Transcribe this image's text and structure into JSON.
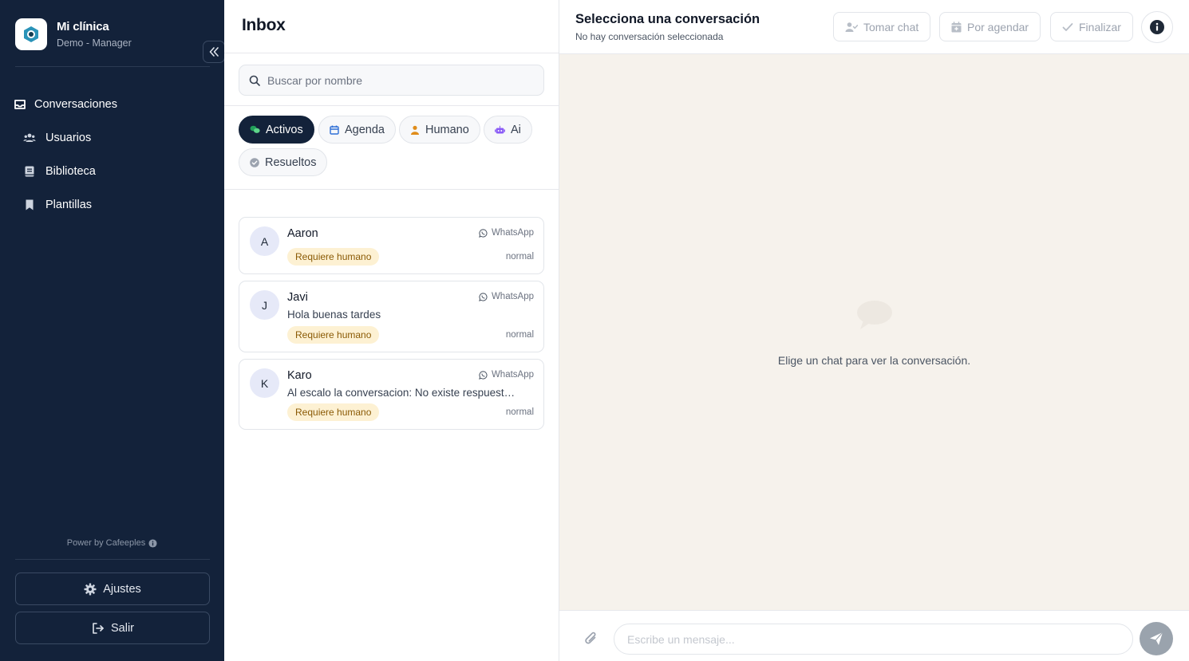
{
  "sidebar": {
    "brand_name": "Mi clínica",
    "brand_role": "Demo - Manager",
    "nav": [
      {
        "label": "Conversaciones",
        "icon": "inbox-icon"
      },
      {
        "label": "Usuarios",
        "icon": "users-icon"
      },
      {
        "label": "Biblioteca",
        "icon": "book-icon"
      },
      {
        "label": "Plantillas",
        "icon": "bookmark-icon"
      }
    ],
    "powered_by": "Power by Cafeeples",
    "settings_label": "Ajustes",
    "logout_label": "Salir"
  },
  "inbox": {
    "title": "Inbox",
    "search_placeholder": "Buscar por nombre",
    "filters": [
      {
        "label": "Activos",
        "active": true,
        "icon": "chat-bubbles-icon"
      },
      {
        "label": "Agenda",
        "active": false,
        "icon": "calendar-icon"
      },
      {
        "label": "Humano",
        "active": false,
        "icon": "person-icon"
      },
      {
        "label": "Ai",
        "active": false,
        "icon": "robot-icon"
      },
      {
        "label": "Resueltos",
        "active": false,
        "icon": "check-circle-icon"
      }
    ],
    "conversations": [
      {
        "initial": "A",
        "name": "Aaron",
        "channel": "WhatsApp",
        "message": "",
        "badge": "Requiere humano",
        "priority": "normal"
      },
      {
        "initial": "J",
        "name": "Javi",
        "channel": "WhatsApp",
        "message": "Hola buenas tardes",
        "badge": "Requiere humano",
        "priority": "normal"
      },
      {
        "initial": "K",
        "name": "Karo",
        "channel": "WhatsApp",
        "message": "Al escalo la conversacion: No existe respuesta...",
        "badge": "Requiere humano",
        "priority": "normal"
      }
    ]
  },
  "chat": {
    "title": "Selecciona una conversación",
    "subtitle": "No hay conversación seleccionada",
    "take_chat_label": "Tomar chat",
    "schedule_label": "Por agendar",
    "finish_label": "Finalizar",
    "empty_text": "Elige un chat para ver la conversación.",
    "composer_placeholder": "Escribe un mensaje..."
  },
  "colors": {
    "sidebar_bg": "#13223a",
    "chat_bg": "#f6f2ec",
    "badge_bg": "#fdf1d3",
    "badge_text": "#8a5a05",
    "active_chip": "#13223a"
  }
}
